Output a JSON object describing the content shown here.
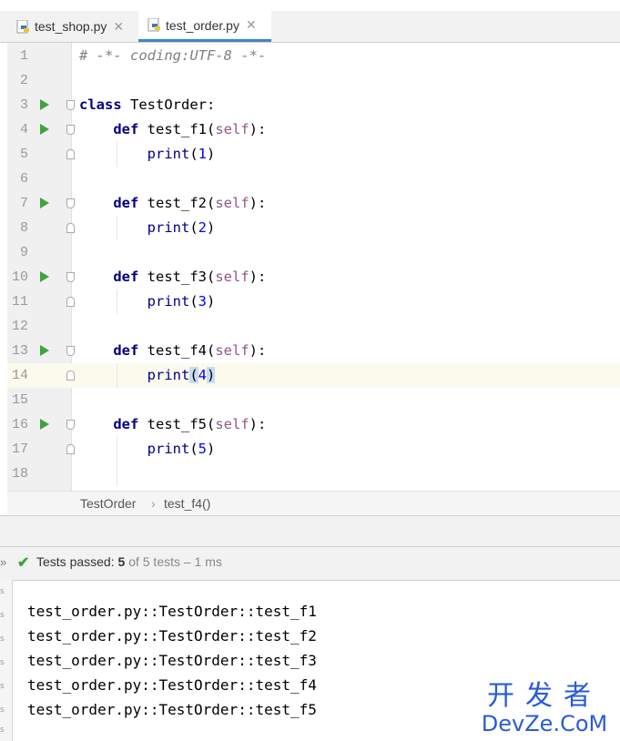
{
  "tabs": [
    {
      "label": "test_shop.py",
      "active": false
    },
    {
      "label": "test_order.py",
      "active": true
    }
  ],
  "code_lines": [
    {
      "n": "1",
      "text": "# -*- coding:UTF-8 -*-"
    },
    {
      "n": "2",
      "text": ""
    },
    {
      "n": "3",
      "text": "class TestOrder:"
    },
    {
      "n": "4",
      "text": "    def test_f1(self):"
    },
    {
      "n": "5",
      "text": "        print(1)"
    },
    {
      "n": "6",
      "text": ""
    },
    {
      "n": "7",
      "text": "    def test_f2(self):"
    },
    {
      "n": "8",
      "text": "        print(2)"
    },
    {
      "n": "9",
      "text": ""
    },
    {
      "n": "10",
      "text": "    def test_f3(self):"
    },
    {
      "n": "11",
      "text": "        print(3)"
    },
    {
      "n": "12",
      "text": ""
    },
    {
      "n": "13",
      "text": "    def test_f4(self):"
    },
    {
      "n": "14",
      "text": "        print(4)"
    },
    {
      "n": "15",
      "text": ""
    },
    {
      "n": "16",
      "text": "    def test_f5(self):"
    },
    {
      "n": "17",
      "text": "        print(5)"
    },
    {
      "n": "18",
      "text": ""
    }
  ],
  "breadcrumb": {
    "class_name": "TestOrder",
    "separator": "›",
    "method": "test_f4()"
  },
  "run": {
    "prefix": "Tests passed:",
    "passed": "5",
    "rest": "of 5 tests – 1 ms"
  },
  "output_lines": [
    "test_order.py::TestOrder::test_f1",
    "test_order.py::TestOrder::test_f2",
    "test_order.py::TestOrder::test_f3",
    "test_order.py::TestOrder::test_f4",
    "test_order.py::TestOrder::test_f5"
  ],
  "watermark": {
    "cn": "开发者",
    "en": "DevZe.CoM"
  },
  "colors": {
    "accent": "#4083c9",
    "run_green": "#3fa33f",
    "keyword": "#000080",
    "self": "#94558d",
    "number": "#0000ff"
  },
  "icons": {
    "run_line": "run-triangle-icon",
    "tab": "python-file-icon",
    "passed": "check-icon"
  }
}
